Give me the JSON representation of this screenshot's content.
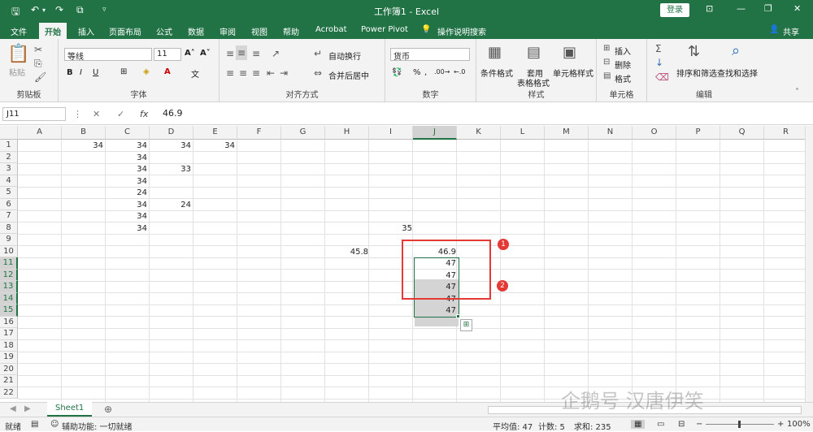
{
  "window": {
    "title": "工作簿1 - Excel",
    "login": "登录"
  },
  "menu": {
    "items": [
      "文件",
      "开始",
      "插入",
      "页面布局",
      "公式",
      "数据",
      "审阅",
      "视图",
      "帮助",
      "Acrobat",
      "Power Pivot"
    ],
    "search": "操作说明搜索",
    "share": "共享"
  },
  "ribbon": {
    "clipboard": {
      "label": "剪贴板",
      "paste": "粘贴"
    },
    "font": {
      "label": "字体",
      "name": "等线",
      "size": "11"
    },
    "alignment": {
      "label": "对齐方式",
      "wrap": "自动换行",
      "merge": "合并后居中"
    },
    "number": {
      "label": "数字",
      "format": "货币"
    },
    "styles": {
      "label": "样式",
      "cond": "条件格式",
      "table_top": "套用",
      "table_bottom": "表格格式",
      "cell": "单元格样式"
    },
    "cells": {
      "label": "单元格",
      "insert": "插入",
      "delete": "删除",
      "format": "格式"
    },
    "editing": {
      "label": "编辑",
      "sort": "排序和筛选",
      "find": "查找和选择"
    }
  },
  "formula_bar": {
    "name_box": "J11",
    "value": "46.9"
  },
  "columns": [
    "A",
    "B",
    "C",
    "D",
    "E",
    "F",
    "G",
    "H",
    "I",
    "J",
    "K",
    "L",
    "M",
    "N",
    "O",
    "P",
    "Q",
    "R"
  ],
  "rows": [
    "1",
    "2",
    "3",
    "4",
    "5",
    "6",
    "7",
    "8",
    "9",
    "10",
    "11",
    "12",
    "13",
    "14",
    "15",
    "16",
    "17",
    "18",
    "19",
    "20",
    "21",
    "22"
  ],
  "cells": {
    "b1": "34",
    "c1": "34",
    "d1": "34",
    "e1": "34",
    "c2": "34",
    "c3": "34",
    "d3": "33",
    "c4": "34",
    "c5": "24",
    "c6": "34",
    "d6": "24",
    "c7": "34",
    "c8": "34",
    "i8": "35",
    "h10": "45.8",
    "j10": "46.9",
    "j11": "47",
    "j12": "47",
    "j13": "47",
    "j14": "47",
    "j15": "47"
  },
  "annotations": {
    "badge1": "1",
    "badge2": "2"
  },
  "sheet_tab": "Sheet1",
  "status": {
    "ready": "就绪",
    "accessibility": "辅助功能: 一切就绪",
    "average": "平均值: 47",
    "count": "计数: 5",
    "sum": "求和: 235",
    "zoom": "100%"
  },
  "watermark": "企鹅号 汉唐伊笑",
  "colors": {
    "excel_green": "#217346",
    "annotation_red": "#e53935"
  }
}
